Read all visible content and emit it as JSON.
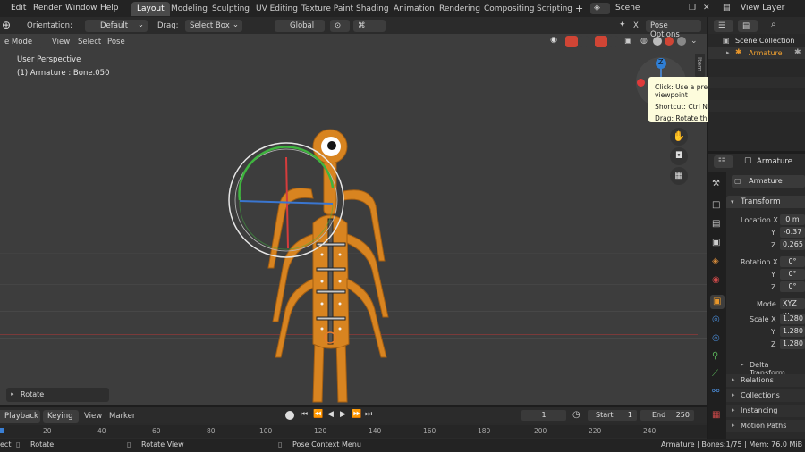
{
  "menubar": {
    "menus": [
      "Edit",
      "Render",
      "Window",
      "Help"
    ],
    "workspaces": [
      "Layout",
      "Modeling",
      "Sculpting",
      "UV Editing",
      "Texture Paint",
      "Shading",
      "Animation",
      "Rendering",
      "Compositing",
      "Scripting"
    ],
    "active_workspace": "Layout",
    "add_tab": "+",
    "scene_label": "Scene",
    "view_layer_label": "View Layer"
  },
  "viewport_header": {
    "orientation_label": "Orientation:",
    "orientation_value": "Default",
    "drag_label": "Drag:",
    "drag_value": "Select Box",
    "transform_orientation": "Global",
    "x_axis": "X",
    "pose_options": "Pose Options",
    "mode": "e Mode",
    "menus": [
      "View",
      "Select",
      "Pose"
    ]
  },
  "viewport": {
    "perspective": "User Perspective",
    "active_object": "(1) Armature : Bone.050",
    "gizmo_axis": "Z",
    "sidebar_tab": "Item",
    "last_operator": "Rotate"
  },
  "tooltip": {
    "line1": "Click: Use a preset viewpoint",
    "line2": "Shortcut: Ctrl Numpad 1",
    "line3": "Drag: Rotate the view"
  },
  "outliner": {
    "collection": "Scene Collection",
    "armature": "Armature"
  },
  "properties": {
    "object_name": "Armature",
    "data_name": "Armature",
    "transform_title": "Transform",
    "location_label": "Location X",
    "location": [
      "0 m",
      "-0.37",
      "0.265"
    ],
    "rotation_label": "Rotation X",
    "rotation": [
      "0°",
      "0°",
      "0°"
    ],
    "mode_label": "Mode",
    "mode_value": "XYZ ...",
    "scale_label": "Scale X",
    "scale": [
      "1.280",
      "1.280",
      "1.280"
    ],
    "axis_y": "Y",
    "axis_z": "Z",
    "sections": [
      "Delta Transform",
      "Relations",
      "Collections",
      "Instancing",
      "Motion Paths"
    ]
  },
  "timeline": {
    "menus": [
      "Playback",
      "Keying",
      "View",
      "Marker"
    ],
    "current_frame": "1",
    "start_label": "Start",
    "start_value": "1",
    "end_label": "End",
    "end_value": "250",
    "ruler": [
      "20",
      "40",
      "60",
      "80",
      "100",
      "120",
      "140",
      "160",
      "180",
      "200",
      "220",
      "240"
    ]
  },
  "statusbar": {
    "left": "ect",
    "rotate": "Rotate",
    "rotate_view": "Rotate View",
    "context_menu": "Pose Context Menu",
    "stats": "Armature | Bones:1/75  |  Mem: 76.0 MiB | 2.90"
  }
}
